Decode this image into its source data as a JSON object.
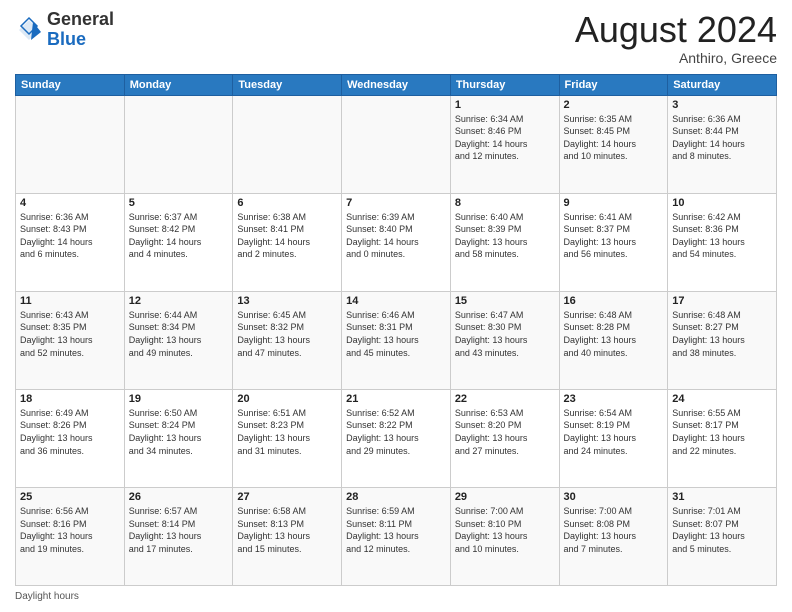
{
  "header": {
    "logo_general": "General",
    "logo_blue": "Blue",
    "month_year": "August 2024",
    "location": "Anthiro, Greece"
  },
  "footer": {
    "daylight_label": "Daylight hours"
  },
  "weekdays": [
    "Sunday",
    "Monday",
    "Tuesday",
    "Wednesday",
    "Thursday",
    "Friday",
    "Saturday"
  ],
  "weeks": [
    [
      {
        "day": "",
        "info": ""
      },
      {
        "day": "",
        "info": ""
      },
      {
        "day": "",
        "info": ""
      },
      {
        "day": "",
        "info": ""
      },
      {
        "day": "1",
        "info": "Sunrise: 6:34 AM\nSunset: 8:46 PM\nDaylight: 14 hours\nand 12 minutes."
      },
      {
        "day": "2",
        "info": "Sunrise: 6:35 AM\nSunset: 8:45 PM\nDaylight: 14 hours\nand 10 minutes."
      },
      {
        "day": "3",
        "info": "Sunrise: 6:36 AM\nSunset: 8:44 PM\nDaylight: 14 hours\nand 8 minutes."
      }
    ],
    [
      {
        "day": "4",
        "info": "Sunrise: 6:36 AM\nSunset: 8:43 PM\nDaylight: 14 hours\nand 6 minutes."
      },
      {
        "day": "5",
        "info": "Sunrise: 6:37 AM\nSunset: 8:42 PM\nDaylight: 14 hours\nand 4 minutes."
      },
      {
        "day": "6",
        "info": "Sunrise: 6:38 AM\nSunset: 8:41 PM\nDaylight: 14 hours\nand 2 minutes."
      },
      {
        "day": "7",
        "info": "Sunrise: 6:39 AM\nSunset: 8:40 PM\nDaylight: 14 hours\nand 0 minutes."
      },
      {
        "day": "8",
        "info": "Sunrise: 6:40 AM\nSunset: 8:39 PM\nDaylight: 13 hours\nand 58 minutes."
      },
      {
        "day": "9",
        "info": "Sunrise: 6:41 AM\nSunset: 8:37 PM\nDaylight: 13 hours\nand 56 minutes."
      },
      {
        "day": "10",
        "info": "Sunrise: 6:42 AM\nSunset: 8:36 PM\nDaylight: 13 hours\nand 54 minutes."
      }
    ],
    [
      {
        "day": "11",
        "info": "Sunrise: 6:43 AM\nSunset: 8:35 PM\nDaylight: 13 hours\nand 52 minutes."
      },
      {
        "day": "12",
        "info": "Sunrise: 6:44 AM\nSunset: 8:34 PM\nDaylight: 13 hours\nand 49 minutes."
      },
      {
        "day": "13",
        "info": "Sunrise: 6:45 AM\nSunset: 8:32 PM\nDaylight: 13 hours\nand 47 minutes."
      },
      {
        "day": "14",
        "info": "Sunrise: 6:46 AM\nSunset: 8:31 PM\nDaylight: 13 hours\nand 45 minutes."
      },
      {
        "day": "15",
        "info": "Sunrise: 6:47 AM\nSunset: 8:30 PM\nDaylight: 13 hours\nand 43 minutes."
      },
      {
        "day": "16",
        "info": "Sunrise: 6:48 AM\nSunset: 8:28 PM\nDaylight: 13 hours\nand 40 minutes."
      },
      {
        "day": "17",
        "info": "Sunrise: 6:48 AM\nSunset: 8:27 PM\nDaylight: 13 hours\nand 38 minutes."
      }
    ],
    [
      {
        "day": "18",
        "info": "Sunrise: 6:49 AM\nSunset: 8:26 PM\nDaylight: 13 hours\nand 36 minutes."
      },
      {
        "day": "19",
        "info": "Sunrise: 6:50 AM\nSunset: 8:24 PM\nDaylight: 13 hours\nand 34 minutes."
      },
      {
        "day": "20",
        "info": "Sunrise: 6:51 AM\nSunset: 8:23 PM\nDaylight: 13 hours\nand 31 minutes."
      },
      {
        "day": "21",
        "info": "Sunrise: 6:52 AM\nSunset: 8:22 PM\nDaylight: 13 hours\nand 29 minutes."
      },
      {
        "day": "22",
        "info": "Sunrise: 6:53 AM\nSunset: 8:20 PM\nDaylight: 13 hours\nand 27 minutes."
      },
      {
        "day": "23",
        "info": "Sunrise: 6:54 AM\nSunset: 8:19 PM\nDaylight: 13 hours\nand 24 minutes."
      },
      {
        "day": "24",
        "info": "Sunrise: 6:55 AM\nSunset: 8:17 PM\nDaylight: 13 hours\nand 22 minutes."
      }
    ],
    [
      {
        "day": "25",
        "info": "Sunrise: 6:56 AM\nSunset: 8:16 PM\nDaylight: 13 hours\nand 19 minutes."
      },
      {
        "day": "26",
        "info": "Sunrise: 6:57 AM\nSunset: 8:14 PM\nDaylight: 13 hours\nand 17 minutes."
      },
      {
        "day": "27",
        "info": "Sunrise: 6:58 AM\nSunset: 8:13 PM\nDaylight: 13 hours\nand 15 minutes."
      },
      {
        "day": "28",
        "info": "Sunrise: 6:59 AM\nSunset: 8:11 PM\nDaylight: 13 hours\nand 12 minutes."
      },
      {
        "day": "29",
        "info": "Sunrise: 7:00 AM\nSunset: 8:10 PM\nDaylight: 13 hours\nand 10 minutes."
      },
      {
        "day": "30",
        "info": "Sunrise: 7:00 AM\nSunset: 8:08 PM\nDaylight: 13 hours\nand 7 minutes."
      },
      {
        "day": "31",
        "info": "Sunrise: 7:01 AM\nSunset: 8:07 PM\nDaylight: 13 hours\nand 5 minutes."
      }
    ]
  ]
}
